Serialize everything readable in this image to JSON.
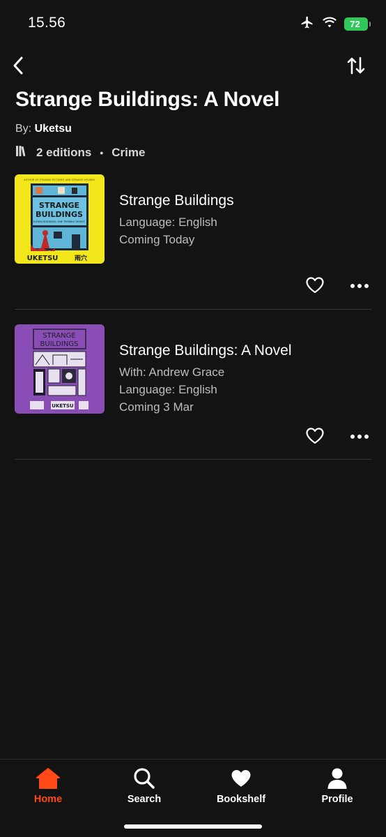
{
  "status_bar": {
    "time": "15.56",
    "battery": "72",
    "icons": [
      "airplane-icon",
      "wifi-icon",
      "battery-icon"
    ]
  },
  "nav": {
    "back_icon": "chevron-left-icon",
    "sort_icon": "sort-arrows-icon"
  },
  "header": {
    "title": "Strange Buildings: A Novel",
    "by_prefix": "By:",
    "author": "Uketsu",
    "editions_count": "2 editions",
    "separator": "•",
    "genre": "Crime"
  },
  "editions": [
    {
      "title": "Strange Buildings",
      "lines": [
        "Language: English",
        "Coming Today"
      ],
      "cover": {
        "bg": "#f2e71a",
        "title": "STRANGE BUILDINGS",
        "author": "UKETSU",
        "kanji": "雨穴",
        "top_text": "AUTHOR OF STRANGE PICTURES AND STRANGE HOUSES",
        "subtitle": "ELEVEN BUILDINGS. ONE TERRIBLE SECRET."
      }
    },
    {
      "title": "Strange Buildings: A Novel",
      "lines": [
        "With: Andrew Grace",
        "Language: English",
        "Coming 3 Mar"
      ],
      "cover": {
        "bg": "#8a4db5",
        "title_line1": "STRANGE",
        "title_line2": "BUILDINGS",
        "author": "UKETSU"
      }
    }
  ],
  "tabs": [
    {
      "label": "Home",
      "icon": "home-icon",
      "active": true
    },
    {
      "label": "Search",
      "icon": "search-icon",
      "active": false
    },
    {
      "label": "Bookshelf",
      "icon": "heart-icon",
      "active": false
    },
    {
      "label": "Profile",
      "icon": "profile-icon",
      "active": false
    }
  ],
  "colors": {
    "background": "#131313",
    "accent": "#ff4a17",
    "battery_green": "#30c85a",
    "secondary_text": "#bdbdbd"
  }
}
